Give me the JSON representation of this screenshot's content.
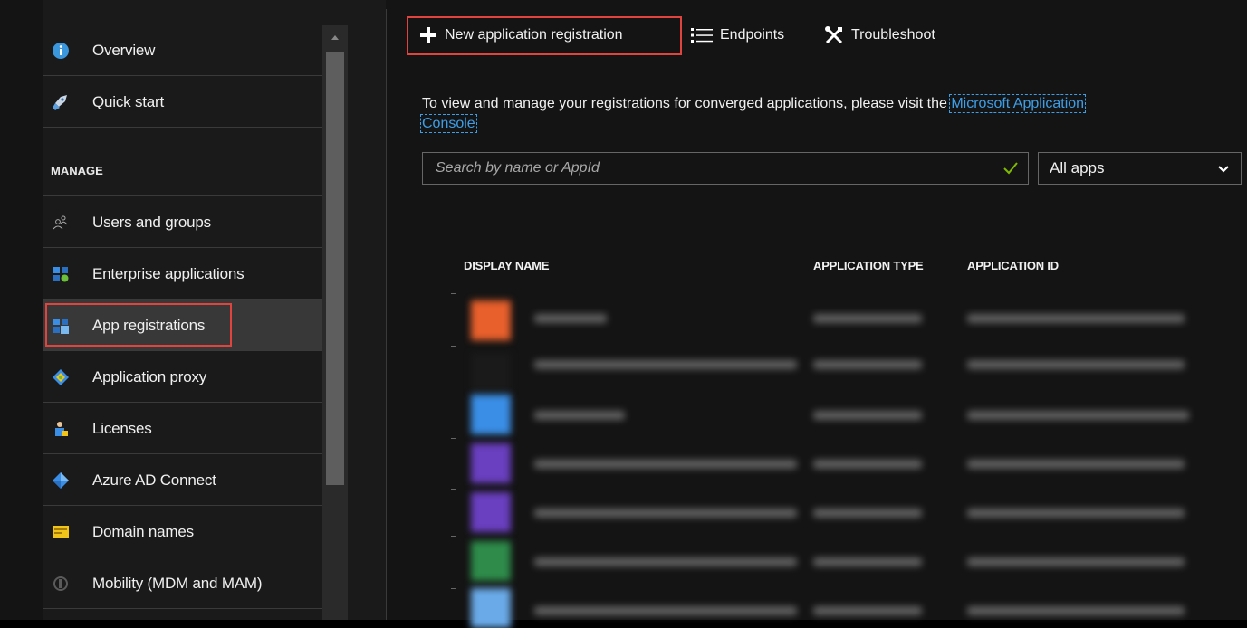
{
  "sidebar": {
    "items": [
      {
        "label": "Overview",
        "icon": "info-icon"
      },
      {
        "label": "Quick start",
        "icon": "rocket-icon"
      }
    ],
    "section_header": "MANAGE",
    "manage_items": [
      {
        "label": "Users and groups",
        "icon": "users-icon"
      },
      {
        "label": "Enterprise applications",
        "icon": "enterprise-apps-icon"
      },
      {
        "label": "App registrations",
        "icon": "app-registrations-icon",
        "active": true
      },
      {
        "label": "Application proxy",
        "icon": "application-proxy-icon"
      },
      {
        "label": "Licenses",
        "icon": "licenses-icon"
      },
      {
        "label": "Azure AD Connect",
        "icon": "azure-ad-connect-icon"
      },
      {
        "label": "Domain names",
        "icon": "domain-names-icon"
      },
      {
        "label": "Mobility (MDM and MAM)",
        "icon": "mobility-icon"
      }
    ]
  },
  "toolbar": {
    "new_registration_label": "New application registration",
    "endpoints_label": "Endpoints",
    "troubleshoot_label": "Troubleshoot"
  },
  "info": {
    "text": "To view and manage your registrations for converged applications, please visit the ",
    "link_part1": "Microsoft Application",
    "link_part2": "Console"
  },
  "search": {
    "placeholder": "Search by name or AppId"
  },
  "filter": {
    "selected": "All apps"
  },
  "table": {
    "columns": [
      "DISPLAY NAME",
      "APPLICATION TYPE",
      "APPLICATION ID"
    ]
  },
  "colors": {
    "highlight": "#e0443e",
    "link": "#3d9ee8",
    "accent_check": "#7fba00",
    "row_icon_colors": [
      "#e8602c",
      "#1a1a1a",
      "#3a8ee6",
      "#6a3fc0",
      "#6a3fc0",
      "#2e8b4a",
      "#6aaae8"
    ]
  }
}
